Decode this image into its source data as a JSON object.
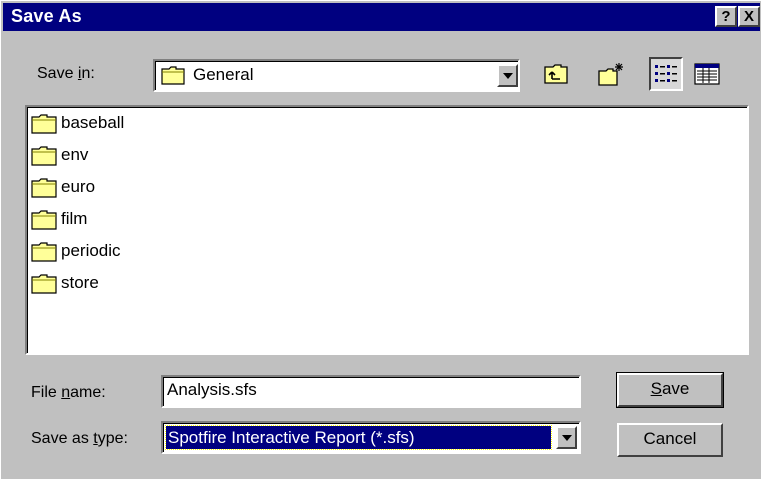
{
  "window": {
    "title": "Save As",
    "help_label": "?",
    "close_label": "X"
  },
  "save_in": {
    "label_pre": "Save ",
    "label_key": "i",
    "label_post": "n:",
    "value": "General"
  },
  "toolbar": {
    "icons": [
      "up-one-level-icon",
      "create-new-folder-icon",
      "list-view-icon",
      "details-view-icon"
    ]
  },
  "files": [
    {
      "name": "baseball",
      "icon": "folder-icon"
    },
    {
      "name": "env",
      "icon": "folder-icon"
    },
    {
      "name": "euro",
      "icon": "folder-icon"
    },
    {
      "name": "film",
      "icon": "folder-icon"
    },
    {
      "name": "periodic",
      "icon": "folder-icon"
    },
    {
      "name": "store",
      "icon": "folder-icon"
    }
  ],
  "file_name": {
    "label_pre": "File ",
    "label_key": "n",
    "label_post": "ame:",
    "value": "Analysis.sfs"
  },
  "save_as_type": {
    "label_pre": "Save as ",
    "label_key": "t",
    "label_post": "ype:",
    "value": "Spotfire Interactive Report (*.sfs)"
  },
  "buttons": {
    "save_key": "S",
    "save_rest": "ave",
    "cancel": "Cancel"
  },
  "colors": {
    "titlebar": "#000080",
    "face": "#c0c0c0",
    "folder": "#ffff99"
  }
}
